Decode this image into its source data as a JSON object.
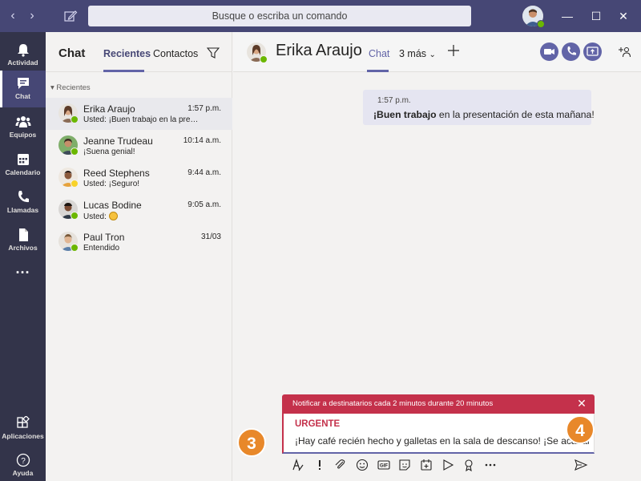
{
  "titlebar": {
    "search_placeholder": "Busque o escriba un comando"
  },
  "rail": {
    "items": [
      {
        "label": "Actividad",
        "icon": "bell-icon"
      },
      {
        "label": "Chat",
        "icon": "chat-icon"
      },
      {
        "label": "Equipos",
        "icon": "teams-icon"
      },
      {
        "label": "Calendario",
        "icon": "calendar-icon"
      },
      {
        "label": "Llamadas",
        "icon": "phone-icon"
      },
      {
        "label": "Archivos",
        "icon": "files-icon"
      }
    ],
    "more": "···",
    "bottom": [
      {
        "label": "Aplicaciones",
        "icon": "apps-icon"
      },
      {
        "label": "Ayuda",
        "icon": "help-icon"
      }
    ]
  },
  "chatlist": {
    "title": "Chat",
    "tabs": [
      "Recientes",
      "Contactos"
    ],
    "section": "Recientes",
    "chats": [
      {
        "name": "Erika Araujo",
        "time": "1:57 p.m.",
        "preview": "Usted: ¡Buen trabajo en la presentación de esta mañana!",
        "presence": "#6bb700"
      },
      {
        "name": "Jeanne Trudeau",
        "time": "10:14 a.m.",
        "preview": "¡Suena genial!",
        "presence": "#6bb700"
      },
      {
        "name": "Reed Stephens",
        "time": "9:44 a.m.",
        "preview": "Usted: ¡Seguro!",
        "presence": "#f8d22a"
      },
      {
        "name": "Lucas Bodine",
        "time": "9:05 a.m.",
        "preview": "Usted: ",
        "presence": "#6bb700"
      },
      {
        "name": "Paul Tron",
        "time": "31/03",
        "preview": "Entendido",
        "presence": "#6bb700"
      }
    ]
  },
  "main": {
    "contact_name": "Erika Araujo",
    "tabs": [
      "Chat",
      "3 más"
    ],
    "message": {
      "time": "1:57 p.m.",
      "bold": "¡Buen trabajo",
      "rest": " en la presentación de esta mañana!"
    }
  },
  "compose": {
    "notify": "Notificar a destinatarios cada 2 minutos durante 20 minutos",
    "urgent": "URGENTE",
    "text": "¡Hay café recién hecho y galletas en la sala de descanso! ¡Se acaban!"
  },
  "callouts": [
    "3",
    "4"
  ],
  "colors": {
    "accent": "#6264a7",
    "titlebar": "#464775",
    "rail": "#33344a",
    "urgent": "#c4314b",
    "callout": "#e8882a"
  }
}
